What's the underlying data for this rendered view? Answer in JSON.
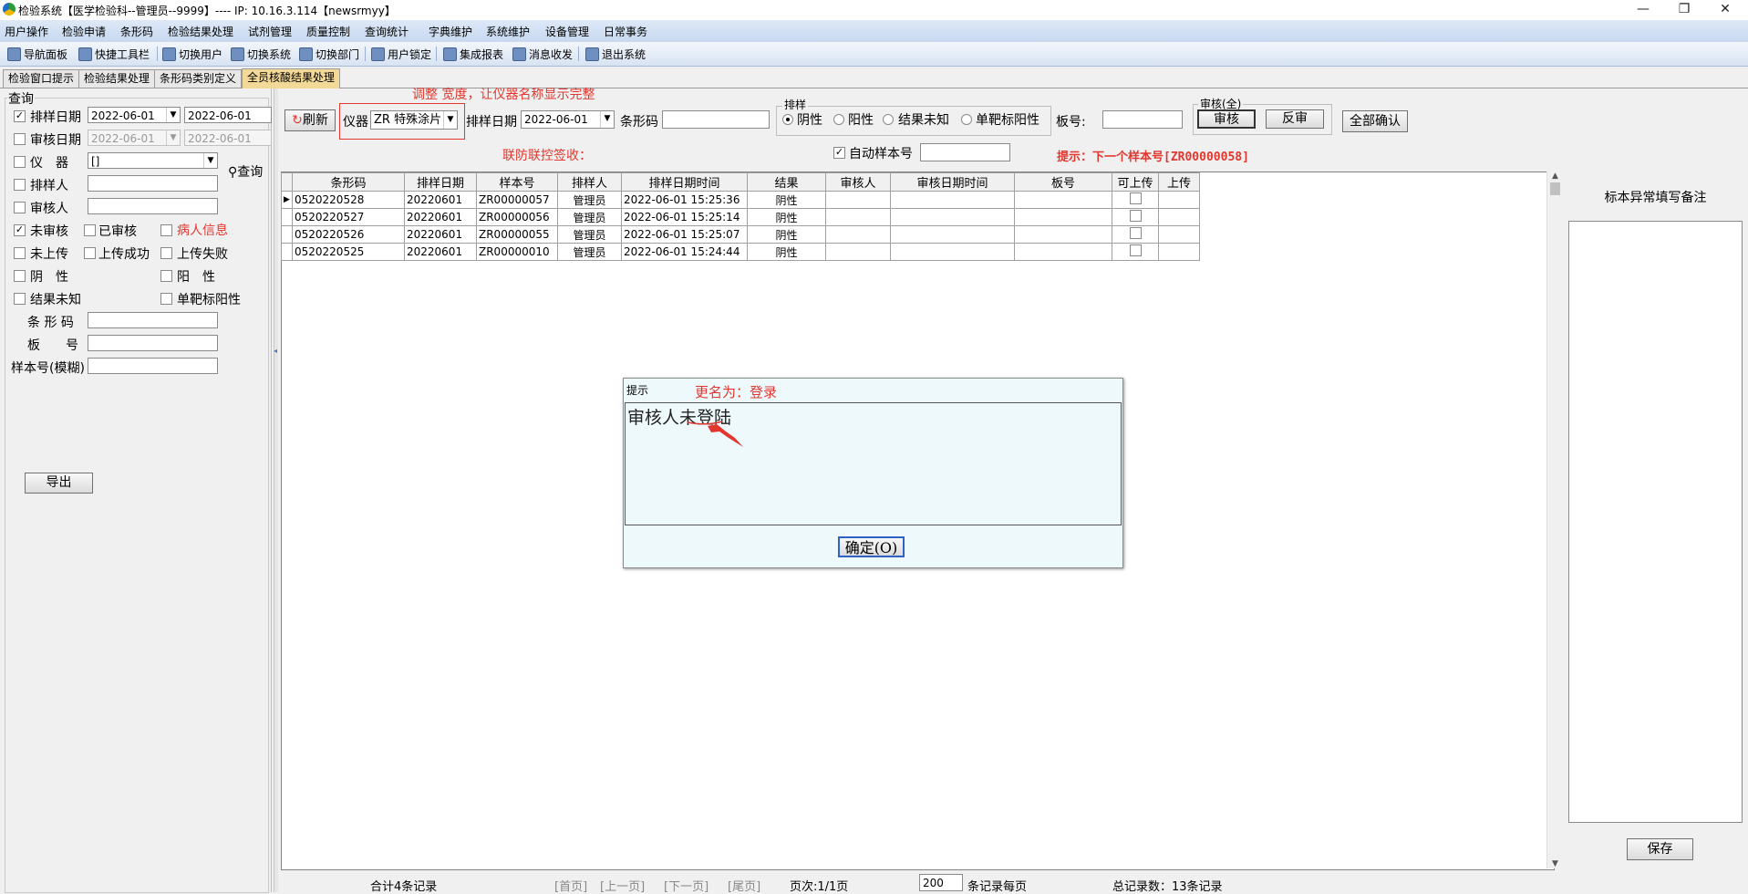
{
  "window": {
    "title": "检验系统【医学检验科--管理员--9999】---- IP: 10.16.3.114【newsrmyy】"
  },
  "menu": [
    "用户操作",
    "检验申请",
    "条形码",
    "检验结果处理",
    "试剂管理",
    "质量控制",
    "查询统计",
    "字典维护",
    "系统维护",
    "设备管理",
    "日常事务"
  ],
  "toolbar": [
    "导航面板",
    "快捷工具栏",
    "切换用户",
    "切换系统",
    "切换部门",
    "用户锁定",
    "集成报表",
    "消息收发",
    "退出系统"
  ],
  "tabs": [
    "检验窗口提示",
    "检验结果处理",
    "条形码类别定义",
    "全员核酸结果处理"
  ],
  "query": {
    "group": "查询",
    "sort_date_label": "排样日期",
    "sort_date_from": "2022-06-01",
    "sort_date_to": "2022-06-01",
    "audit_date_label": "审核日期",
    "audit_date_from": "2022-06-01",
    "audit_date_to": "2022-06-01",
    "instrument_label": "仪　器",
    "instrument_value": "[]",
    "sorter_label": "排样人",
    "auditor_label": "审核人",
    "query_btn": "查询",
    "unaudited": "未审核",
    "audited": "已审核",
    "patient_info": "病人信息",
    "not_uploaded": "未上传",
    "upload_ok": "上传成功",
    "upload_fail": "上传失败",
    "negative": "阴　性",
    "positive": "阳　性",
    "unknown": "结果未知",
    "single_target": "单靶标阳性",
    "barcode_label": "条 形 码",
    "plate_label": "板　　号",
    "sample_label": "样本号(模糊)",
    "export_btn": "导出"
  },
  "top": {
    "refresh": "刷新",
    "instrument_label": "仪器",
    "instrument_code": "ZR",
    "instrument_name": "特殊涂片",
    "sort_date_label": "排样日期",
    "sort_date": "2022-06-01",
    "barcode_label": "条形码",
    "sort_group": "排样",
    "negative": "阴性",
    "positive": "阳性",
    "unknown": "结果未知",
    "single_target": "单靶标阳性",
    "plate_label": "板号:",
    "audit_group": "审核(全)",
    "audit_btn": "审核",
    "unaudit_btn": "反审",
    "confirm_all": "全部确认",
    "auto_sample": "自动样本号",
    "annotation1": "调整 宽度，让仪器名称显示完整",
    "annotation2": "联防联控签收：",
    "hint": "提示：下一个样本号[ZR00000058]"
  },
  "table": {
    "headers": [
      "条形码",
      "排样日期",
      "样本号",
      "排样人",
      "排样日期时间",
      "结果",
      "审核人",
      "审核日期时间",
      "板号",
      "可上传",
      "上传"
    ],
    "rows": [
      [
        "0520220528",
        "20220601",
        "ZR00000057",
        "管理员",
        "2022-06-01 15:25:36",
        "阴性",
        "",
        "",
        "",
        "",
        ""
      ],
      [
        "0520220527",
        "20220601",
        "ZR00000056",
        "管理员",
        "2022-06-01 15:25:14",
        "阴性",
        "",
        "",
        "",
        "",
        ""
      ],
      [
        "0520220526",
        "20220601",
        "ZR00000055",
        "管理员",
        "2022-06-01 15:25:07",
        "阴性",
        "",
        "",
        "",
        "",
        ""
      ],
      [
        "0520220525",
        "20220601",
        "ZR00000010",
        "管理员",
        "2022-06-01 15:24:44",
        "阴性",
        "",
        "",
        "",
        "",
        ""
      ]
    ]
  },
  "right": {
    "title": "标本异常填写备注",
    "save": "保存"
  },
  "dialog": {
    "title": "提示",
    "annotation": "更名为：登录",
    "message": "审核人未登陆",
    "ok": "确定(O)"
  },
  "footer": {
    "total": "合计4条记录",
    "first": "[首页]",
    "prev": "[上一页]",
    "next": "[下一页]",
    "last": "[尾页]",
    "page": "页次:1/1页",
    "per_page_value": "200",
    "per_page_label": "条记录每页",
    "records": "总记录数：13条记录"
  },
  "colors": {
    "annotation_red": "#e3362e",
    "active_tab": "#f3d998",
    "dialog_bg": "#eef9fc",
    "menubar": "#c7d8f0"
  }
}
